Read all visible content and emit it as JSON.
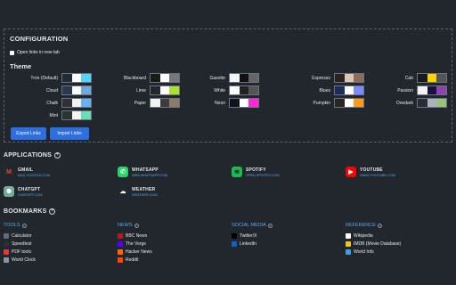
{
  "configuration": {
    "title": "CONFIGURATION",
    "open_in_new_tab_label": "Open links in new tab",
    "theme_title": "Theme",
    "themes": [
      {
        "name": "Tron (Default)",
        "colors": [
          "#232a33",
          "#ffffff",
          "#54d4ff"
        ]
      },
      {
        "name": "Cloud",
        "colors": [
          "#2b3a4a",
          "#ffffff",
          "#6fa8dc"
        ]
      },
      {
        "name": "Chalk",
        "colors": [
          "#2e3136",
          "#f2f2f2",
          "#6ab0f0"
        ]
      },
      {
        "name": "Mint",
        "colors": [
          "#293533",
          "#f4f4f4",
          "#66e0b0"
        ]
      },
      {
        "name": "Blackboard",
        "colors": [
          "#1a1a1a",
          "#ffffff",
          "#777777"
        ]
      },
      {
        "name": "Lime",
        "colors": [
          "#22272e",
          "#ffffff",
          "#a6e22e"
        ]
      },
      {
        "name": "Paper",
        "colors": [
          "#f3f3f3",
          "#3c3c3c",
          "#8a7a66"
        ]
      },
      {
        "name": "Gazette",
        "colors": [
          "#f5f5f5",
          "#111111",
          "#666666"
        ]
      },
      {
        "name": "White",
        "colors": [
          "#ffffff",
          "#222222",
          "#555555"
        ]
      },
      {
        "name": "Neon",
        "colors": [
          "#101418",
          "#ffffff",
          "#ff2ad4"
        ]
      },
      {
        "name": "Espresso",
        "colors": [
          "#2a2320",
          "#d9c8b4",
          "#8b6d5a"
        ]
      },
      {
        "name": "Blues",
        "colors": [
          "#1b2b5a",
          "#ffffff",
          "#7a8cff"
        ]
      },
      {
        "name": "Pumpkin",
        "colors": [
          "#2a2522",
          "#ffffff",
          "#ff9a1a"
        ]
      },
      {
        "name": "Cab",
        "colors": [
          "#1a1a1a",
          "#ffd200",
          "#555555"
        ]
      },
      {
        "name": "Passion",
        "colors": [
          "#f2f2f2",
          "#1a1040",
          "#8e44ad"
        ]
      },
      {
        "name": "Onedark",
        "colors": [
          "#282c34",
          "#abb2bf",
          "#98c379"
        ]
      }
    ],
    "export_label": "Export Links",
    "import_label": "Import Links"
  },
  "applications": {
    "title": "APPLICATIONS",
    "items": [
      {
        "name": "GMAIL",
        "url": "MAIL.GOOGLE.COM",
        "icon": "gmail-icon",
        "glyph": "M",
        "bg": "transparent",
        "fg": "#ea4335"
      },
      {
        "name": "WHATSAPP",
        "url": "WEB.WHATSAPP.COM",
        "icon": "whatsapp-icon",
        "glyph": "✆",
        "bg": "#25d366",
        "fg": "#ffffff"
      },
      {
        "name": "SPOTIFY",
        "url": "OPEN.SPOTIFY.COM",
        "icon": "spotify-icon",
        "glyph": "≋",
        "bg": "#1db954",
        "fg": "#111111"
      },
      {
        "name": "YOUTUBE",
        "url": "WWW.YOUTUBE.COM",
        "icon": "youtube-icon",
        "glyph": "▶",
        "bg": "#ff0000",
        "fg": "#ffffff"
      },
      {
        "name": "CHATGPT",
        "url": "CHATGPT.COM",
        "icon": "chatgpt-icon",
        "glyph": "✺",
        "bg": "#74aa9c",
        "fg": "#ffffff"
      },
      {
        "name": "WEATHER",
        "url": "WEATHER.COM",
        "icon": "weather-icon",
        "glyph": "☁",
        "bg": "transparent",
        "fg": "#ffffff"
      }
    ]
  },
  "bookmarks": {
    "title": "BOOKMARKS",
    "groups": [
      {
        "title": "TOOLS",
        "items": [
          {
            "label": "Calculator",
            "icon": "calculator-icon",
            "color": "#5f6b7a"
          },
          {
            "label": "Speedtest",
            "icon": "speedtest-icon",
            "color": "#2a2f36"
          },
          {
            "label": "PDF tools",
            "icon": "pdf-icon",
            "color": "#e53935"
          },
          {
            "label": "World Clock",
            "icon": "clock-icon",
            "color": "#8a95a3"
          }
        ]
      },
      {
        "title": "NEWS",
        "items": [
          {
            "label": "BBC News",
            "icon": "bbc-icon",
            "color": "#bb1919"
          },
          {
            "label": "The Verge",
            "icon": "verge-icon",
            "color": "#5200ff"
          },
          {
            "label": "Hacker News",
            "icon": "hackernews-icon",
            "color": "#ff6600"
          },
          {
            "label": "Reddit",
            "icon": "reddit-icon",
            "color": "#ff4500"
          }
        ]
      },
      {
        "title": "SOCIAL MEDIA",
        "items": [
          {
            "label": "Twitter/X",
            "icon": "x-icon",
            "color": "#000000"
          },
          {
            "label": "LinkedIn",
            "icon": "linkedin-icon",
            "color": "#0a66c2"
          }
        ]
      },
      {
        "title": "REFERENCE",
        "items": [
          {
            "label": "Wikipedia",
            "icon": "wikipedia-icon",
            "color": "#ffffff"
          },
          {
            "label": "IMDB (Movie Database)",
            "icon": "imdb-icon",
            "color": "#f5c518"
          },
          {
            "label": "World Info",
            "icon": "globe-icon",
            "color": "#3fa0e0"
          }
        ]
      }
    ]
  },
  "colors": {
    "background": "#22272e",
    "accent_link": "#5aa9e6",
    "button": "#2d6fe0"
  }
}
